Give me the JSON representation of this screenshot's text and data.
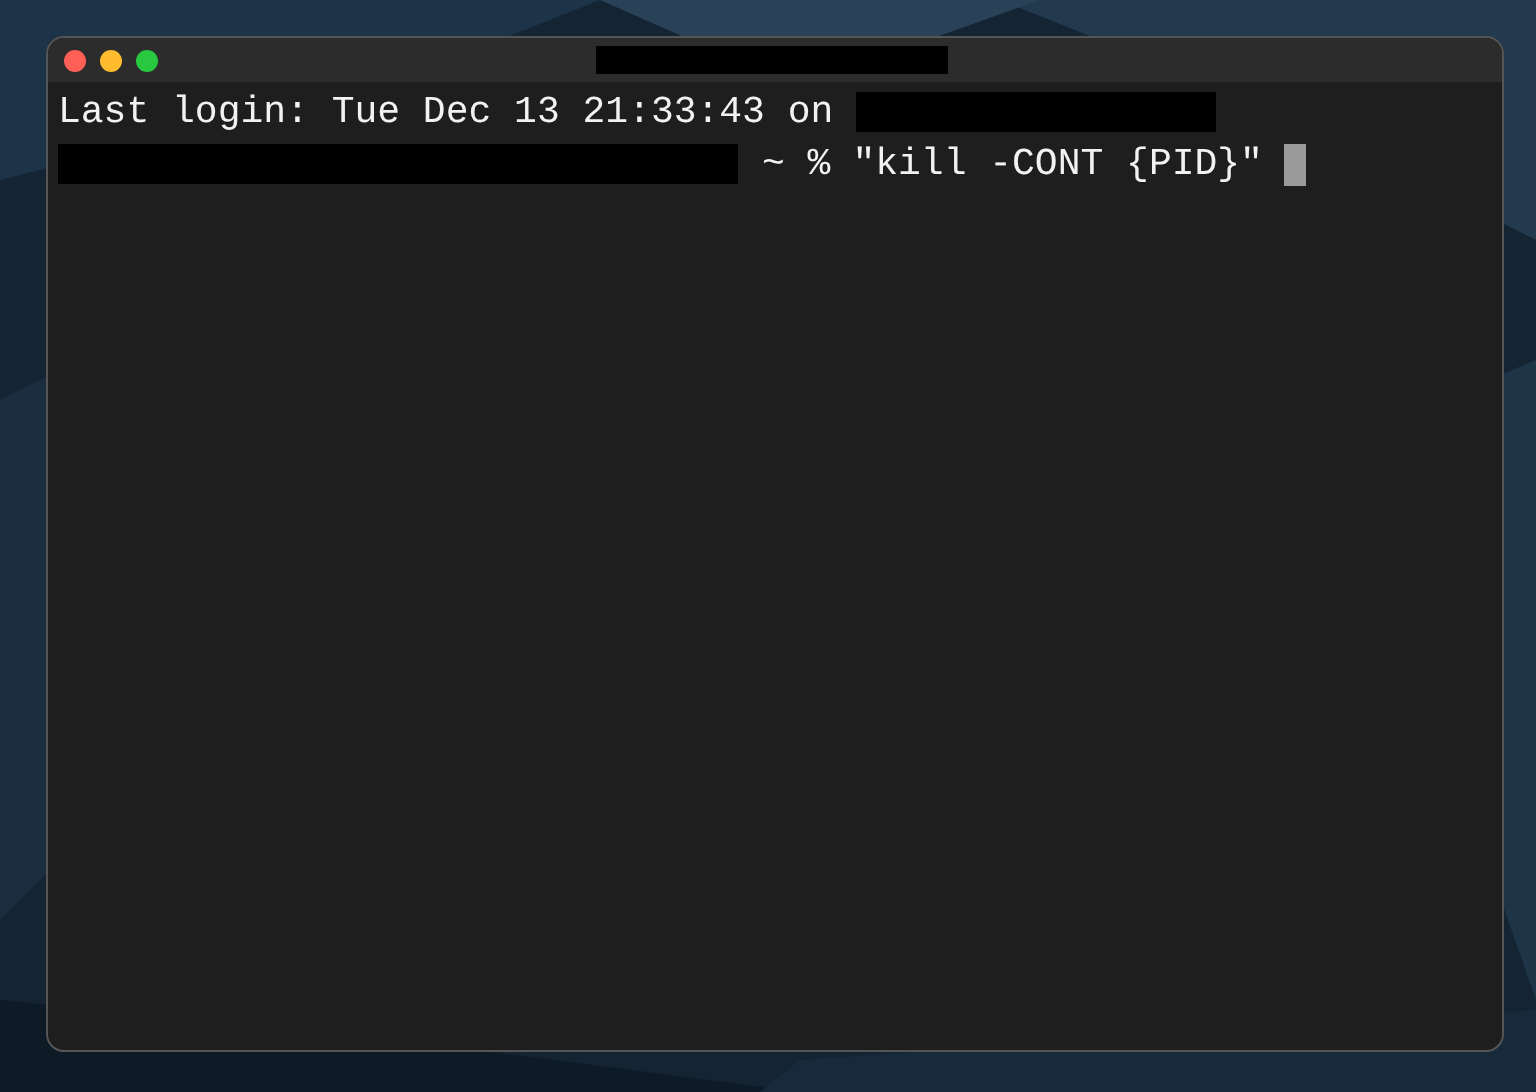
{
  "window": {
    "lines": [
      {
        "kind": "login",
        "text": "Last login: Tue Dec 13 21:33:43 on"
      },
      {
        "kind": "prompt",
        "prompt": "~ %",
        "command": "\"kill -CONT {PID}\"",
        "cursor": true
      }
    ]
  }
}
